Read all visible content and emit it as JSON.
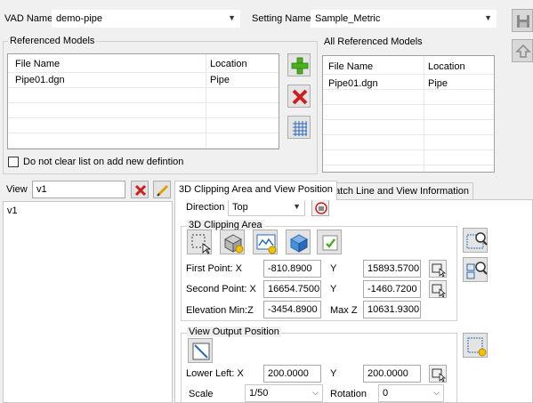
{
  "top": {
    "vad_label": "VAD Name",
    "vad_value": "demo-pipe",
    "setting_label": "Setting Name",
    "setting_value": "Sample_Metric"
  },
  "referenced_models": {
    "title": "Referenced Models",
    "col_file": "File Name",
    "col_location": "Location",
    "rows": [
      {
        "file": "Pipe01.dgn",
        "location": "Pipe"
      }
    ]
  },
  "all_referenced_models": {
    "title": "All Referenced Models",
    "col_file": "File Name",
    "col_location": "Location",
    "rows": [
      {
        "file": "Pipe01.dgn",
        "location": "Pipe"
      }
    ]
  },
  "do_not_clear": {
    "label": "Do not clear list on add new defintion",
    "checked": false
  },
  "view": {
    "label": "View",
    "value": "v1",
    "list": [
      "v1"
    ]
  },
  "tabs": [
    {
      "label": "3D Clipping Area and View Position",
      "active": true
    },
    {
      "label": "Match Line and View Information",
      "active": false
    }
  ],
  "direction": {
    "label": "Direction",
    "value": "Top"
  },
  "clipping": {
    "title": "3D Clipping Area",
    "first_point_label": "First Point: X",
    "first_x": "-810.8900",
    "y_label": "Y",
    "first_y": "15893.5700",
    "second_point_label": "Second Point: X",
    "second_x": "16654.7500",
    "second_y": "-1460.7200",
    "elev_min_label": "Elevation Min:Z",
    "elev_min": "-3454.8900",
    "max_z_label": "Max Z",
    "max_z": "10631.9300"
  },
  "output": {
    "title": "View Output Position",
    "lower_left_label": "Lower Left: X",
    "lower_left_x": "200.0000",
    "y_label": "Y",
    "lower_left_y": "200.0000",
    "scale_label": "Scale",
    "scale_value": "1/50",
    "rotation_label": "Rotation",
    "rotation_value": "0"
  },
  "icons": {
    "save": "save-icon",
    "upload": "upload-icon",
    "add": "green-plus-icon",
    "delete": "red-x-icon",
    "grid": "grid-icon",
    "edit": "pencil-icon"
  },
  "colors": {
    "accent_green": "#4caf1e",
    "delete_red": "#cc1f1f",
    "icon_blue": "#2a6ab8"
  }
}
